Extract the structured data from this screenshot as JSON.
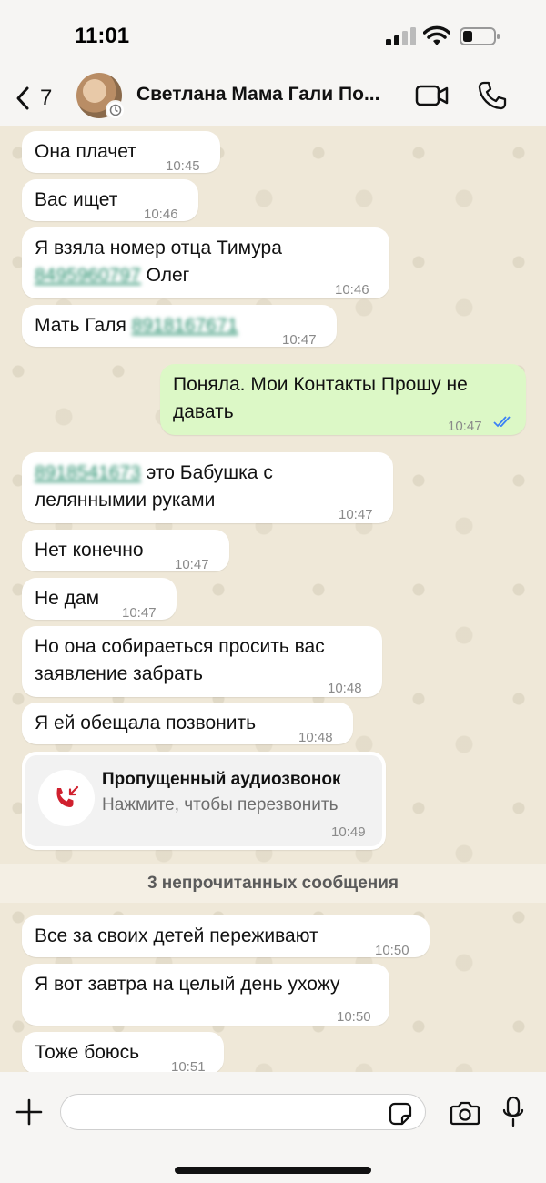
{
  "status_bar": {
    "time": "11:01"
  },
  "header": {
    "back_count": "7",
    "contact_name": "Светлана Мама Гали По..."
  },
  "messages": [
    {
      "text": "Она плачет",
      "time": "10:45"
    },
    {
      "text": "Вас ищет",
      "time": "10:46"
    },
    {
      "text_line1": "Я взяла номер отца Тимура",
      "phone": "8495960797",
      "text_after": " Олег",
      "time": "10:46"
    },
    {
      "text_before": "Мать Галя ",
      "phone": "8918167671",
      "time": "10:47"
    },
    {
      "text_line1": "Поняла. Мои Контакты Прошу не",
      "text_line2": "давать",
      "time": "10:47",
      "outgoing": true
    },
    {
      "phone": "8918541673",
      "text_after": " это Бабушка с",
      "text_line2": "леляннымии  руками",
      "time": "10:47"
    },
    {
      "text": "Нет конечно",
      "time": "10:47"
    },
    {
      "text": "Не дам",
      "time": "10:47"
    },
    {
      "text_line1": "Но она собираеться просить вас",
      "text_line2": "заявление  забрать",
      "time": "10:48"
    },
    {
      "text": "Я ей обещала позвонить",
      "time": "10:48"
    },
    {
      "text": "Все за своих детей переживают",
      "time": "10:50"
    },
    {
      "text": "Я вот завтра на целый день ухожу",
      "time": "10:50"
    },
    {
      "text": "Тоже боюсь",
      "time": "10:51"
    }
  ],
  "missed_call": {
    "title": "Пропущенный аудиозвонок",
    "subtitle": "Нажмите, чтобы перезвонить",
    "time": "10:49"
  },
  "unread_divider": "3 непрочитанных сообщения",
  "input": {
    "placeholder": ""
  },
  "colors": {
    "incoming_bubble": "#ffffff",
    "outgoing_bubble": "#dcf8c6",
    "link": "#1e8a67",
    "missed_call_red": "#d0202e",
    "read_ticks": "#3b82f6"
  },
  "icons": [
    "back-chevron-icon",
    "video-call-icon",
    "phone-call-icon",
    "missed-call-icon",
    "plus-icon",
    "sticker-icon",
    "camera-icon",
    "microphone-icon",
    "wifi-icon",
    "battery-icon",
    "signal-icon"
  ]
}
